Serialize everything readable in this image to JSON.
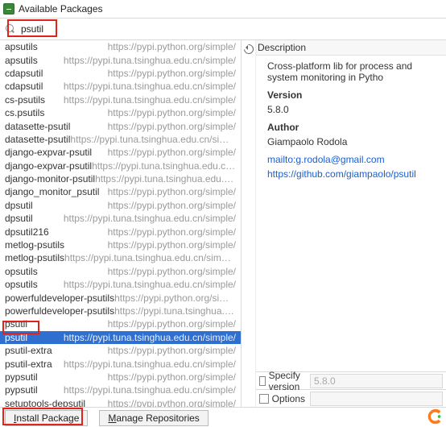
{
  "window": {
    "title": "Available Packages"
  },
  "search": {
    "value": "psutil"
  },
  "packages": [
    {
      "name": "apsutils",
      "url": "https://pypi.python.org/simple/"
    },
    {
      "name": "apsutils",
      "url": "https://pypi.tuna.tsinghua.edu.cn/simple/"
    },
    {
      "name": "cdapsutil",
      "url": "https://pypi.python.org/simple/"
    },
    {
      "name": "cdapsutil",
      "url": "https://pypi.tuna.tsinghua.edu.cn/simple/"
    },
    {
      "name": "cs-psutils",
      "url": "https://pypi.tuna.tsinghua.edu.cn/simple/"
    },
    {
      "name": "cs.psutils",
      "url": "https://pypi.python.org/simple/"
    },
    {
      "name": "datasette-psutil",
      "url": "https://pypi.python.org/simple/"
    },
    {
      "name": "datasette-psutil",
      "url": "https://pypi.tuna.tsinghua.edu.cn/simple/"
    },
    {
      "name": "django-expvar-psutil",
      "url": "https://pypi.python.org/simple/"
    },
    {
      "name": "django-expvar-psutil",
      "url": "https://pypi.tuna.tsinghua.edu.cn/simple/"
    },
    {
      "name": "django-monitor-psutil",
      "url": "https://pypi.tuna.tsinghua.edu.cn/simple/"
    },
    {
      "name": "django_monitor_psutil",
      "url": "https://pypi.python.org/simple/"
    },
    {
      "name": "dpsutil",
      "url": "https://pypi.python.org/simple/"
    },
    {
      "name": "dpsutil",
      "url": "https://pypi.tuna.tsinghua.edu.cn/simple/"
    },
    {
      "name": "dpsutil216",
      "url": "https://pypi.python.org/simple/"
    },
    {
      "name": "metlog-psutils",
      "url": "https://pypi.python.org/simple/"
    },
    {
      "name": "metlog-psutils",
      "url": "https://pypi.tuna.tsinghua.edu.cn/simple/"
    },
    {
      "name": "opsutils",
      "url": "https://pypi.python.org/simple/"
    },
    {
      "name": "opsutils",
      "url": "https://pypi.tuna.tsinghua.edu.cn/simple/"
    },
    {
      "name": "powerfuldeveloper-psutils",
      "url": "https://pypi.python.org/simple/"
    },
    {
      "name": "powerfuldeveloper-psutils",
      "url": "https://pypi.tuna.tsinghua.edu.cn/simple/"
    },
    {
      "name": "psutil",
      "url": "https://pypi.python.org/simple/"
    },
    {
      "name": "psutil",
      "url": "https://pypi.tuna.tsinghua.edu.cn/simple/",
      "selected": true
    },
    {
      "name": "psutil-extra",
      "url": "https://pypi.python.org/simple/"
    },
    {
      "name": "psutil-extra",
      "url": "https://pypi.tuna.tsinghua.edu.cn/simple/"
    },
    {
      "name": "pypsutil",
      "url": "https://pypi.python.org/simple/"
    },
    {
      "name": "pypsutil",
      "url": "https://pypi.tuna.tsinghua.edu.cn/simple/"
    },
    {
      "name": "setuptools-depsutil",
      "url": "https://pypi.python.org/simple/"
    }
  ],
  "description": {
    "panel_label": "Description",
    "summary": "Cross-platform lib for process and system monitoring in Pytho",
    "version_label": "Version",
    "version": "5.8.0",
    "author_label": "Author",
    "author": "Giampaolo Rodola",
    "mailto": "mailto:g.rodola@gmail.com",
    "homepage": "https://github.com/giampaolo/psutil"
  },
  "options": {
    "specify_version_label": "Specify version",
    "specify_version_value": "5.8.0",
    "options_label": "Options"
  },
  "footer": {
    "install_label_pre": "I",
    "install_label_post": "nstall Package",
    "manage_label_pre": "M",
    "manage_label_post": "anage Repositories"
  }
}
